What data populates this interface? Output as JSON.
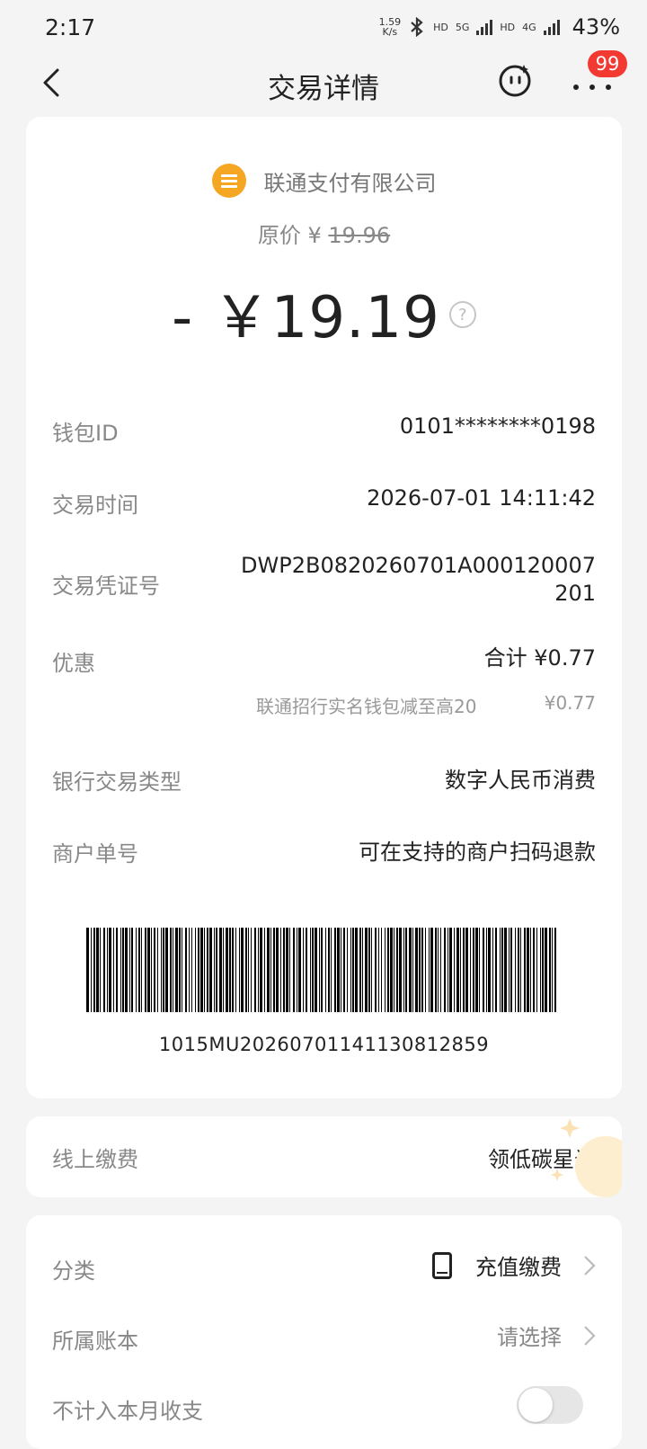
{
  "status_bar": {
    "time": "2:17",
    "net_speed_value": "1.59",
    "net_speed_unit": "K/s",
    "hd1": "HD",
    "network1": "5G",
    "hd2": "HD",
    "network2": "4G",
    "battery": "43%"
  },
  "header": {
    "title": "交易详情",
    "badge_count": "99"
  },
  "transaction": {
    "merchant": "联通支付有限公司",
    "original_price_label": "原价 ¥",
    "original_price_value": "19.96",
    "amount": "- ￥19.19",
    "help_symbol": "?"
  },
  "details": {
    "wallet_id": {
      "label": "钱包ID",
      "value": "0101********0198"
    },
    "trade_time": {
      "label": "交易时间",
      "value": "2026-07-01 14:11:42"
    },
    "voucher_no": {
      "label": "交易凭证号",
      "value_line1": "DWP2B0820260701A000120007",
      "value_line2": "201"
    },
    "discount": {
      "label": "优惠",
      "total": "合计  ¥0.77",
      "item_name": "联通招行实名钱包减至高20",
      "item_value": "¥0.77"
    },
    "bank_type": {
      "label": "银行交易类型",
      "value": "数字人民币消费"
    },
    "merchant_no": {
      "label": "商户单号",
      "value": "可在支持的商户扫码退款"
    }
  },
  "barcode": {
    "number": "1015MU20260701141130812859"
  },
  "online_payment": {
    "label": "线上缴费",
    "value": "领低碳星光"
  },
  "bookkeeping": {
    "category_label": "分类",
    "category_value": "充值缴费",
    "category_icon": "phone-icon",
    "ledger_label": "所属账本",
    "ledger_value": "请选择",
    "exclude_label": "不计入本月收支",
    "exclude_on": false
  }
}
